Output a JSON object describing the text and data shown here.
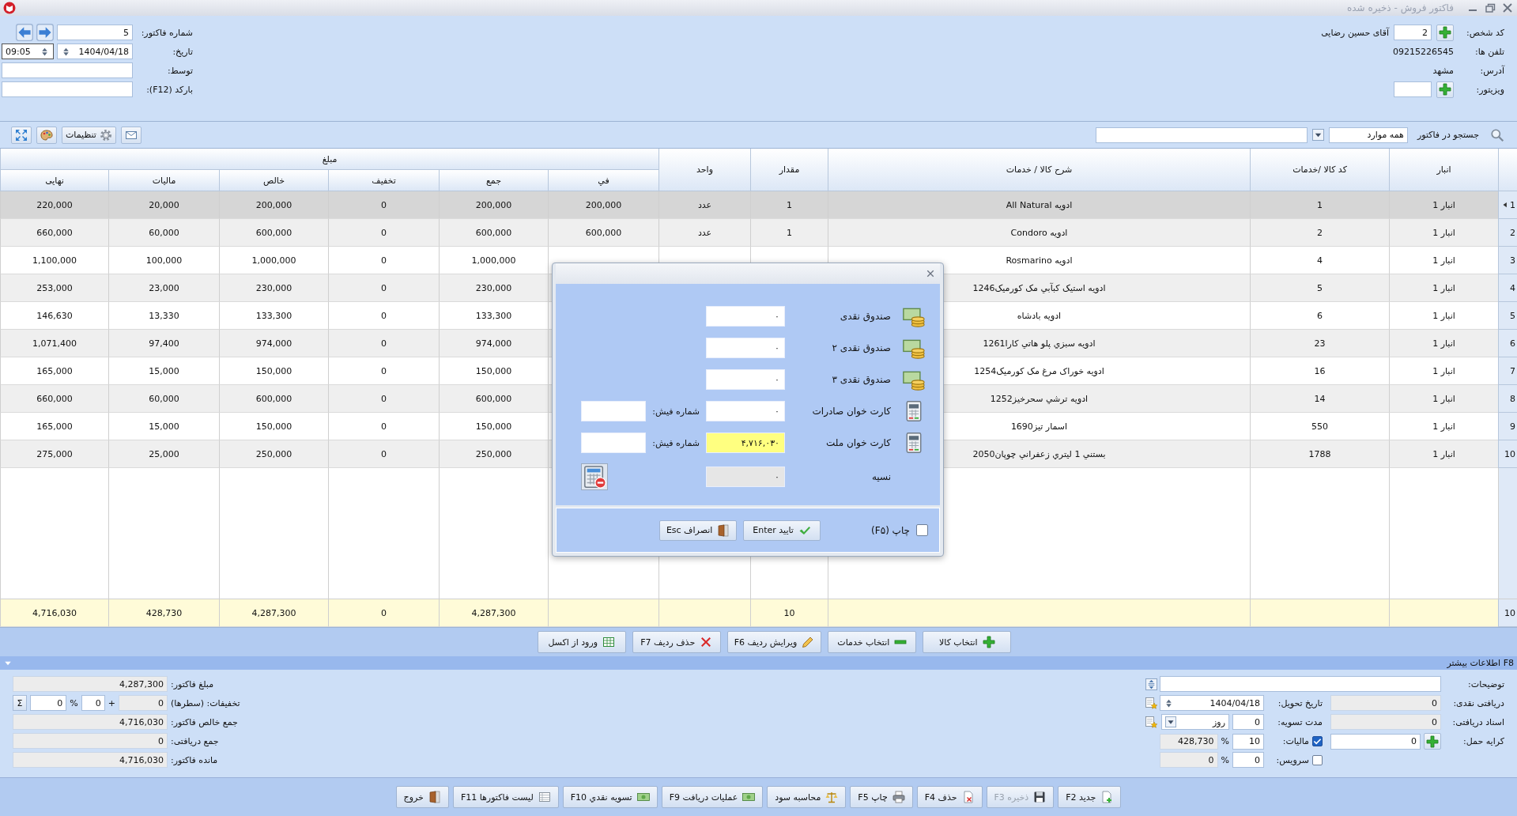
{
  "window": {
    "title": "فاکتور فروش - ذخیره شده"
  },
  "header": {
    "customer": {
      "code_label": "کد شخص:",
      "code": "2",
      "name": "آقای حسین رضایی",
      "phones_label": "تلفن ها:",
      "phones": "09215226545",
      "address_label": "آدرس:",
      "address": "مشهد",
      "visitor_label": "ویزیتور:"
    },
    "invoice": {
      "number_label": "شماره فاکتور:",
      "number": "5",
      "date_label": "تاریخ:",
      "date": "1404/04/18",
      "time": "09:05",
      "by_label": "توسط:",
      "barcode_label": "بارکد (F12):"
    }
  },
  "toolbar": {
    "search_label": "جستجو در فاکتور",
    "scope": "همه موارد",
    "settings_label": "تنظیمات"
  },
  "table": {
    "group_header": "مبلغ",
    "columns": [
      "انبار",
      "کد کالا /خدمات",
      "شرح کالا / خدمات",
      "مقدار",
      "واحد",
      "في",
      "جمع",
      "تخفیف",
      "خالص",
      "مالیات",
      "نهایی"
    ],
    "rows": [
      {
        "num": "1",
        "selected": true,
        "cells": [
          "انبار 1",
          "1",
          "ادویه All Natural",
          "1",
          "عدد",
          "200,000",
          "200,000",
          "0",
          "200,000",
          "20,000",
          "220,000"
        ]
      },
      {
        "num": "2",
        "selected": false,
        "cells": [
          "انبار 1",
          "2",
          "ادویه Condoro",
          "1",
          "عدد",
          "600,000",
          "600,000",
          "0",
          "600,000",
          "60,000",
          "660,000"
        ]
      },
      {
        "num": "3",
        "selected": false,
        "cells": [
          "انبار 1",
          "4",
          "ادویه Rosmarino",
          null,
          null,
          null,
          "1,000,000",
          "0",
          "1,000,000",
          "100,000",
          "1,100,000"
        ]
      },
      {
        "num": "4",
        "selected": false,
        "cells": [
          "انبار 1",
          "5",
          "ادویه استیک کبآبي مک کورمیک1246",
          null,
          null,
          null,
          "230,000",
          "0",
          "230,000",
          "23,000",
          "253,000"
        ]
      },
      {
        "num": "5",
        "selected": false,
        "cells": [
          "انبار 1",
          "6",
          "ادویه بادشاه",
          null,
          null,
          null,
          "133,300",
          "0",
          "133,300",
          "13,330",
          "146,630"
        ]
      },
      {
        "num": "6",
        "selected": false,
        "cells": [
          "انبار 1",
          "23",
          "ادویه سبزي پلو هاتي کارا1261",
          null,
          null,
          null,
          "974,000",
          "0",
          "974,000",
          "97,400",
          "1,071,400"
        ]
      },
      {
        "num": "7",
        "selected": false,
        "cells": [
          "انبار 1",
          "16",
          "ادویه خوراک مرغ مک کورمیک1254",
          null,
          null,
          null,
          "150,000",
          "0",
          "150,000",
          "15,000",
          "165,000"
        ]
      },
      {
        "num": "8",
        "selected": false,
        "cells": [
          "انبار 1",
          "14",
          "ادویه ترشي سحرخیز1252",
          null,
          null,
          null,
          "600,000",
          "0",
          "600,000",
          "60,000",
          "660,000"
        ]
      },
      {
        "num": "9",
        "selected": false,
        "cells": [
          "انبار 1",
          "550",
          "اسمار تیز1690",
          null,
          null,
          null,
          "150,000",
          "0",
          "150,000",
          "15,000",
          "165,000"
        ]
      },
      {
        "num": "10",
        "selected": false,
        "cells": [
          "انبار 1",
          "1788",
          "بستني 1 لیتري زعفراني چوپان2050",
          null,
          null,
          null,
          "250,000",
          "0",
          "250,000",
          "25,000",
          "275,000"
        ]
      }
    ],
    "totals": {
      "num": "10",
      "cells": [
        null,
        null,
        null,
        "10",
        null,
        null,
        "4,287,300",
        "0",
        "4,287,300",
        "428,730",
        "4,716,030"
      ]
    }
  },
  "actions": [
    {
      "label": "انتخاب کالا"
    },
    {
      "label": "انتخاب خدمات"
    },
    {
      "label": "ویرایش ردیف F6"
    },
    {
      "label": "حذف ردیف F7"
    },
    {
      "label": "ورود از اکسل"
    }
  ],
  "more_info": {
    "title": "F8 اطلاعات بیشتر",
    "summary": [
      {
        "kind": "amount",
        "label": "مبلغ فاکتور:",
        "value": "4,287,300"
      },
      {
        "kind": "discount",
        "label": "تخفیفات: (سطرها)",
        "value": "0",
        "plus": "+",
        "percent": "0",
        "percent_sign": "%",
        "amount": "0",
        "sum_button": "Σ"
      },
      {
        "kind": "amount",
        "label": "جمع خالص فاکتور:",
        "value": "4,716,030"
      },
      {
        "kind": "amount",
        "label": "جمع دریافتی:",
        "value": "0"
      },
      {
        "kind": "amount",
        "label": "مانده فاکتور:",
        "value": "4,716,030"
      }
    ],
    "details": {
      "notes_label": "توضیحات:",
      "cash_label": "دریافتی نقدی:",
      "cash": "0",
      "docs_label": "اسناد دریافتی:",
      "docs": "0",
      "freight_label": "کرایه حمل:",
      "freight": "0",
      "delivery_label": "تاریخ تحویل:",
      "delivery_date": "1404/04/18",
      "settle_label": "مدت تسویه:",
      "settle_days": "0",
      "settle_unit": "روز",
      "tax": {
        "label": "مالیات:",
        "checked": true,
        "percent": "10",
        "percent_sign": "%",
        "amount": "428,730"
      },
      "service": {
        "label": "سرویس:",
        "checked": false,
        "percent": "0",
        "percent_sign": "%",
        "amount": "0"
      }
    }
  },
  "bottom_buttons": [
    {
      "label": "جدید F2",
      "disabled": false
    },
    {
      "label": "ذخیره F3",
      "disabled": true
    },
    {
      "label": "حذف F4",
      "disabled": false
    },
    {
      "label": "چاپ F5",
      "disabled": false
    },
    {
      "label": "محاسبه سود",
      "disabled": false
    },
    {
      "label": "عملیات دریافت F9",
      "disabled": false
    },
    {
      "label": "تسویه نقدي F10",
      "disabled": false
    },
    {
      "label": "لیست فاکتورها F11",
      "disabled": false
    },
    {
      "label": "خروج",
      "disabled": false
    }
  ],
  "payment_dialog": {
    "rows": [
      {
        "kind": "cash",
        "label": "صندوق نقدی",
        "value": "۰",
        "highlighted": false
      },
      {
        "kind": "cash",
        "label": "صندوق نقدی ۲",
        "value": "۰",
        "highlighted": false
      },
      {
        "kind": "cash",
        "label": "صندوق نقدی ۳",
        "value": "۰",
        "highlighted": false
      },
      {
        "kind": "card",
        "label": "کارت خوان صادرات",
        "value": "۰",
        "highlighted": false,
        "receipt_label": "شماره فیش:"
      },
      {
        "kind": "card",
        "label": "کارت خوان ملت",
        "value": "۴,۷۱۶,۰۳۰",
        "highlighted": true,
        "receipt_label": "شماره فیش:"
      },
      {
        "kind": "credit",
        "label": "نسیه",
        "value": "۰",
        "highlighted": false
      }
    ],
    "print": {
      "label": "چاپ (F۵)",
      "checked": false
    },
    "buttons": [
      {
        "label": "تایید Enter"
      },
      {
        "label": "انصراف Esc"
      }
    ]
  }
}
